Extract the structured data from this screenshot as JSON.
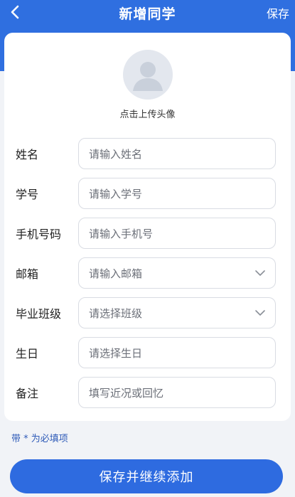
{
  "colors": {
    "brand": "#2f6fe0",
    "button": "#2e6be0",
    "hint": "#2f5bb8"
  },
  "header": {
    "back_icon": "chevron-left-icon",
    "title": "新增同学",
    "save_label": "保存"
  },
  "avatar": {
    "icon": "user-avatar-icon",
    "label": "点击上传头像"
  },
  "form": {
    "fields": [
      {
        "label": "姓名",
        "placeholder": "请输入姓名"
      },
      {
        "label": "学号",
        "placeholder": "请输入学号"
      },
      {
        "label": "手机号码",
        "placeholder": "请输入手机号"
      },
      {
        "label": "邮箱",
        "placeholder": "请输入邮箱",
        "icon": "chevron-down-icon"
      },
      {
        "label": "毕业班级",
        "placeholder": "请选择班级",
        "icon": "chevron-down-icon"
      },
      {
        "label": "生日",
        "placeholder": "请选择生日"
      },
      {
        "label": "备注",
        "placeholder": "填写近况或回忆"
      }
    ]
  },
  "hint": "带 * 为必填项",
  "submit_label": "保存并继续添加"
}
